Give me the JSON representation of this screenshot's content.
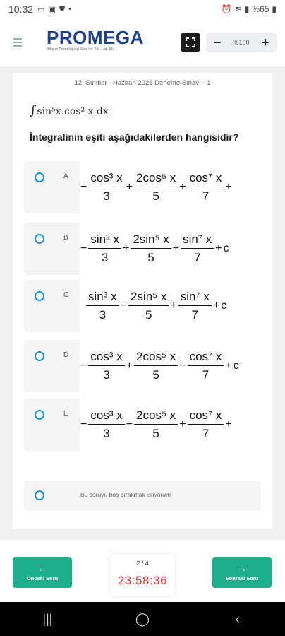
{
  "status_bar": {
    "time": "10:32",
    "battery": "%65"
  },
  "header": {
    "brand": "PROMEGA",
    "brand_sub": "Bilişim Teknolojileri San. ve Tic. Ltd. Şti.",
    "zoom_value": "%100",
    "zoom_minus": "−",
    "zoom_plus": "+"
  },
  "question": {
    "exam_title": "12. Sınıflar - Haziran 2021 Deneme Sınavı - 1",
    "integral": "sin⁵x.cos² x dx",
    "text": "İntegralinin eşiti aşağıdakilerden hangisidir?",
    "options": [
      {
        "letter": "A",
        "lead": "−",
        "terms": [
          {
            "num": "cos³ x",
            "den": "3"
          },
          {
            "op": "+"
          },
          {
            "num": "2cos⁵ x",
            "den": "5"
          },
          {
            "op": "+"
          },
          {
            "num": "cos⁷ x",
            "den": "7"
          },
          {
            "op": "+"
          }
        ],
        "tail": ""
      },
      {
        "letter": "B",
        "lead": "−",
        "terms": [
          {
            "num": "sin³ x",
            "den": "3"
          },
          {
            "op": "+"
          },
          {
            "num": "2sin⁵ x",
            "den": "5"
          },
          {
            "op": "+"
          },
          {
            "num": "sin⁷ x",
            "den": "7"
          },
          {
            "op": "+"
          }
        ],
        "tail": "c"
      },
      {
        "letter": "C",
        "lead": "",
        "terms": [
          {
            "num": "sin³ x",
            "den": "3"
          },
          {
            "op": "−"
          },
          {
            "num": "2sin⁵ x",
            "den": "5"
          },
          {
            "op": "+"
          },
          {
            "num": "sin⁷ x",
            "den": "7"
          },
          {
            "op": "+"
          }
        ],
        "tail": "c"
      },
      {
        "letter": "D",
        "lead": "−",
        "terms": [
          {
            "num": "cos³ x",
            "den": "3"
          },
          {
            "op": "+"
          },
          {
            "num": "2cos⁵ x",
            "den": "5"
          },
          {
            "op": "−"
          },
          {
            "num": "cos⁷ x",
            "den": "7"
          },
          {
            "op": "+"
          }
        ],
        "tail": "c"
      },
      {
        "letter": "E",
        "lead": "−",
        "terms": [
          {
            "num": "cos³ x",
            "den": "3"
          },
          {
            "op": "−"
          },
          {
            "num": "2cos⁵ x",
            "den": "5"
          },
          {
            "op": "+"
          },
          {
            "num": "cos⁷ x",
            "den": "7"
          },
          {
            "op": "+"
          }
        ],
        "tail": ""
      }
    ],
    "skip_text": "Bu soruyu boş bırakmak istiyorum"
  },
  "footer": {
    "prev_label": "Önceki Soru",
    "next_label": "Sonraki Soru",
    "page": "2 / 4",
    "timer": "23:58:36"
  },
  "colors": {
    "accent": "#1fae8a",
    "radio": "#1a8fdc",
    "timer": "#e53935",
    "brand": "#1c3f8f"
  }
}
